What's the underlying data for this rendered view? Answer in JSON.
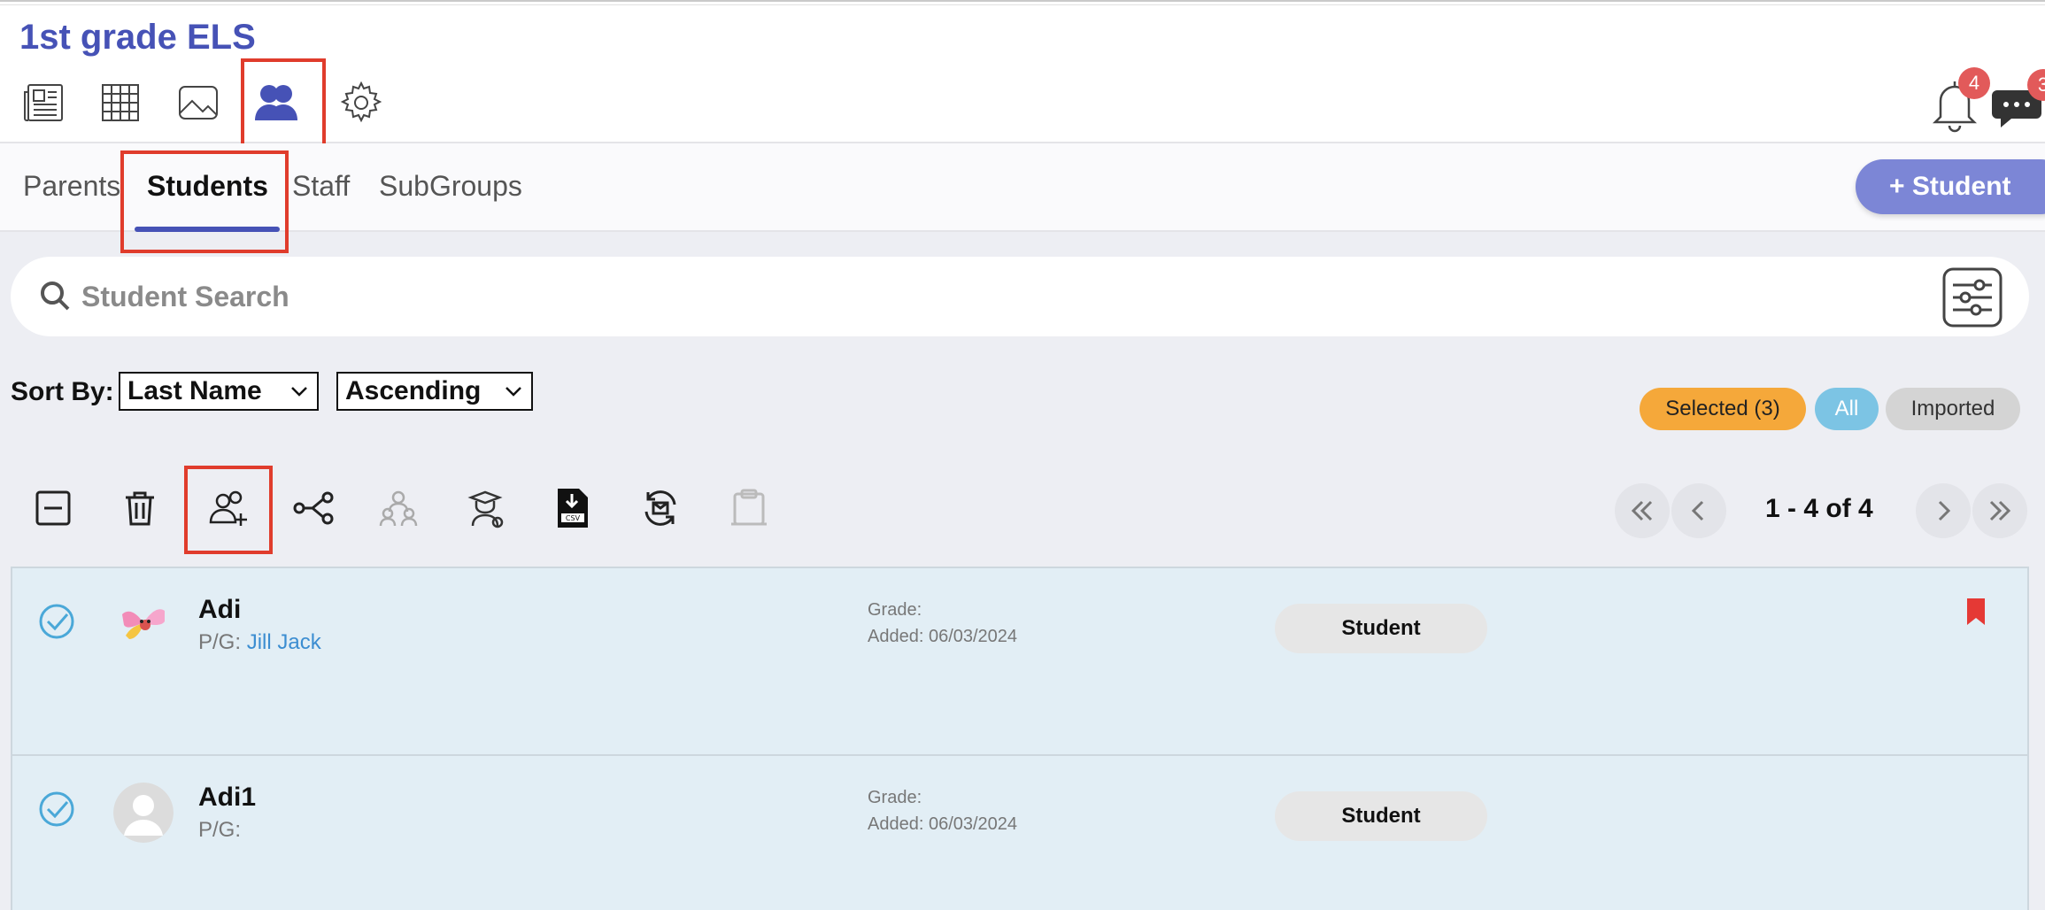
{
  "app": {
    "title": "1st grade ELS"
  },
  "notifications": {
    "bell_count": "4",
    "chat_count": "3"
  },
  "tabs": [
    {
      "label": "Parents"
    },
    {
      "label": "Students"
    },
    {
      "label": "Staff"
    },
    {
      "label": "SubGroups"
    }
  ],
  "active_tab": "Students",
  "add_button": {
    "label": "+ Student"
  },
  "search": {
    "placeholder": "Student Search",
    "value": ""
  },
  "sort": {
    "label": "Sort By:",
    "field": "Last Name",
    "order": "Ascending"
  },
  "filters": {
    "selected": "Selected (3)",
    "all": "All",
    "imported": "Imported"
  },
  "pagination": {
    "text": "1 - 4 of 4"
  },
  "students": [
    {
      "name": "Adi",
      "pg_label": "P/G:",
      "pg_value": "Jill Jack",
      "grade": "Grade:",
      "added": "Added: 06/03/2024",
      "role": "Student",
      "flagged": true
    },
    {
      "name": "Adi1",
      "pg_label": "P/G:",
      "pg_value": "",
      "grade": "Grade:",
      "added": "Added: 06/03/2024",
      "role": "Student",
      "flagged": false
    }
  ],
  "colors": {
    "brand": "#4652b6",
    "accent_button": "#7c86d6",
    "selected_pill": "#f5a83a",
    "all_pill": "#7cc4e4",
    "row_bg": "#e2eef5",
    "highlight": "#e03c2c"
  },
  "icons": [
    "newsletter-icon",
    "calendar-grid-icon",
    "image-icon",
    "people-icon",
    "gear-icon",
    "bell-icon",
    "chat-icon",
    "search-icon",
    "filter-sliders-icon",
    "deselect-icon",
    "trash-icon",
    "add-user-icon",
    "connect-icon",
    "group-users-icon",
    "graduate-icon",
    "csv-download-icon",
    "sync-email-icon",
    "clipboard-icon",
    "first-page-icon",
    "prev-page-icon",
    "next-page-icon",
    "last-page-icon",
    "checkmark-icon",
    "bookmark-icon"
  ]
}
